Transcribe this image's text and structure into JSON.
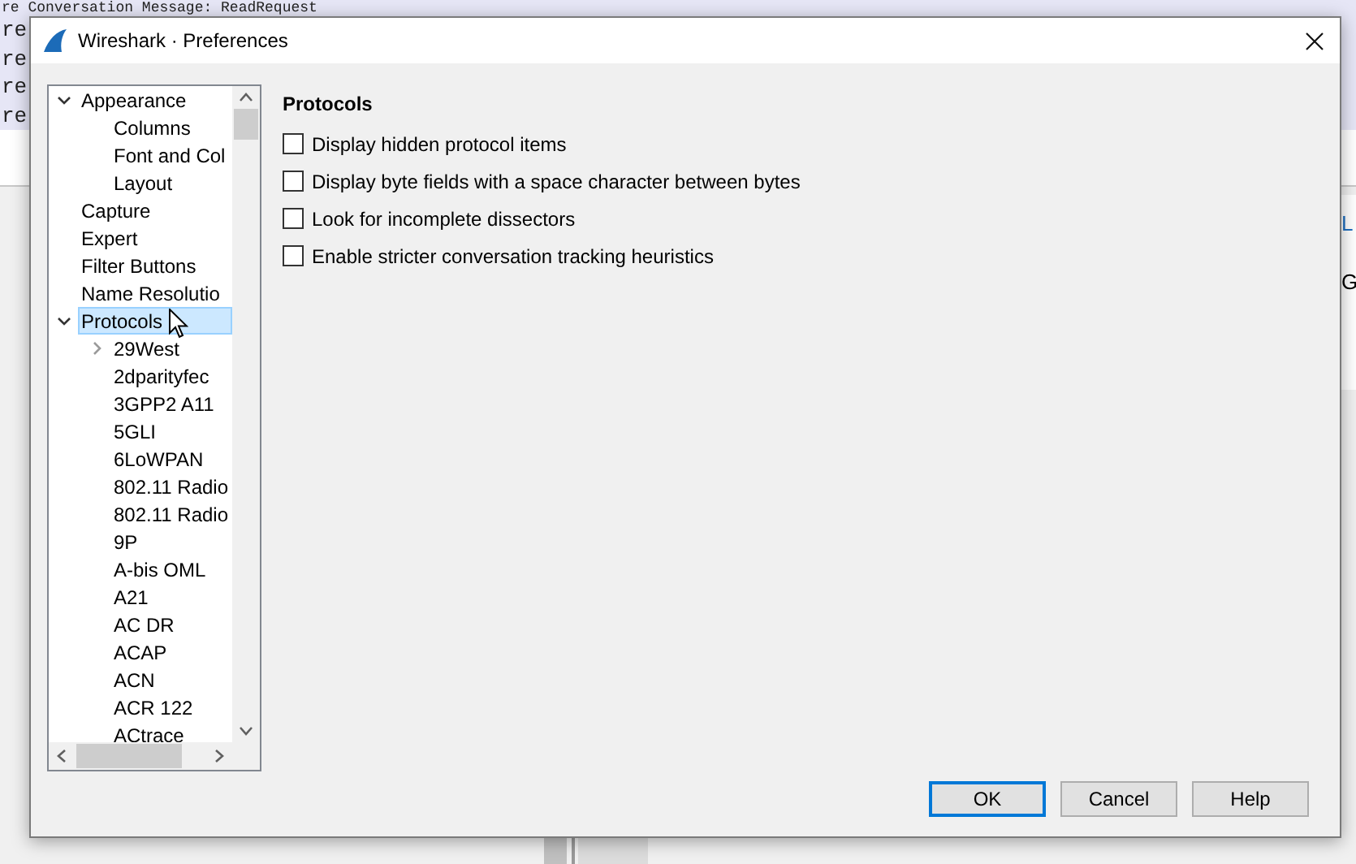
{
  "background": {
    "lines": [
      "re Conversation Message: ReadRequest",
      "re",
      "re",
      "re",
      "re"
    ],
    "side_letters": [
      {
        "text": "L",
        "color": "#1e6fc0"
      },
      {
        "text": "G",
        "color": "#000000"
      }
    ]
  },
  "window": {
    "title": "Wireshark · Preferences"
  },
  "tree": [
    {
      "label": "Appearance",
      "expanded": true,
      "selected": false,
      "children": [
        {
          "label": "Columns",
          "selected": false
        },
        {
          "label": "Font and Col",
          "selected": false
        },
        {
          "label": "Layout",
          "selected": false
        }
      ]
    },
    {
      "label": "Capture",
      "selected": false
    },
    {
      "label": "Expert",
      "selected": false
    },
    {
      "label": "Filter Buttons",
      "selected": false
    },
    {
      "label": "Name Resolutio",
      "selected": false
    },
    {
      "label": "Protocols",
      "expanded": true,
      "selected": true,
      "children": [
        {
          "label": "29West",
          "expanded": false,
          "selected": false
        },
        {
          "label": "2dparityfec",
          "selected": false
        },
        {
          "label": "3GPP2 A11",
          "selected": false
        },
        {
          "label": "5GLI",
          "selected": false
        },
        {
          "label": "6LoWPAN",
          "selected": false
        },
        {
          "label": "802.11 Radio",
          "selected": false
        },
        {
          "label": "802.11 Radio",
          "selected": false
        },
        {
          "label": "9P",
          "selected": false
        },
        {
          "label": "A-bis OML",
          "selected": false
        },
        {
          "label": "A21",
          "selected": false
        },
        {
          "label": "AC DR",
          "selected": false
        },
        {
          "label": "ACAP",
          "selected": false
        },
        {
          "label": "ACN",
          "selected": false
        },
        {
          "label": "ACR 122",
          "selected": false
        },
        {
          "label": "ACtrace",
          "selected": false
        }
      ]
    }
  ],
  "section": {
    "title": "Protocols",
    "options": [
      {
        "label": "Display hidden protocol items",
        "checked": false
      },
      {
        "label": "Display byte fields with a space character between bytes",
        "checked": false
      },
      {
        "label": "Look for incomplete dissectors",
        "checked": false
      },
      {
        "label": "Enable stricter conversation tracking heuristics",
        "checked": false
      }
    ]
  },
  "buttons": [
    {
      "label": "OK",
      "default": true
    },
    {
      "label": "Cancel",
      "default": false
    },
    {
      "label": "Help",
      "default": false
    }
  ]
}
